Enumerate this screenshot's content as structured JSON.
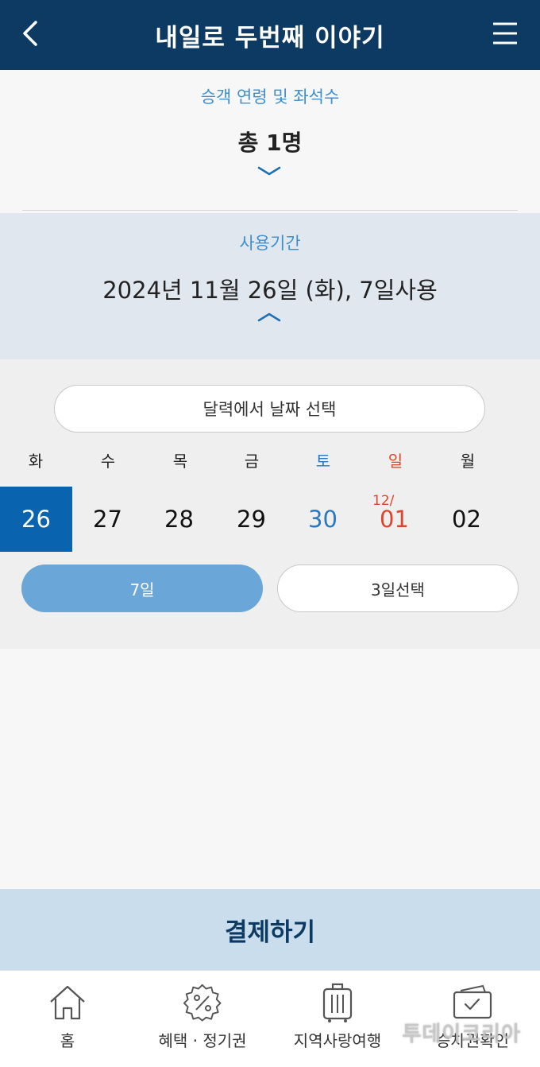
{
  "header": {
    "title": "내일로 두번째 이야기",
    "back_icon": "chevron-left-icon",
    "menu_icon": "hamburger-menu-icon"
  },
  "passenger": {
    "label": "승객 연령 및 좌석수",
    "value": "총 1명",
    "toggle_icon": "chevron-down-icon"
  },
  "period": {
    "label": "사용기간",
    "value": "2024년 11월 26일 (화), 7일사용",
    "toggle_icon": "chevron-up-icon"
  },
  "calendar": {
    "select_button": "달력에서 날짜 선택",
    "weekdays": [
      "화",
      "수",
      "목",
      "금",
      "토",
      "일",
      "월"
    ],
    "dates": [
      "26",
      "27",
      "28",
      "29",
      "30",
      "01",
      "02"
    ],
    "month_prefix": "12/",
    "selected_date": "26"
  },
  "duration": {
    "option_7": "7일",
    "option_3": "3일선택",
    "selected": "7일"
  },
  "pay_button": "결제하기",
  "bottom_nav": {
    "items": [
      {
        "label": "홈",
        "icon": "home-icon"
      },
      {
        "label": "혜택 · 정기권",
        "icon": "discount-badge-icon"
      },
      {
        "label": "지역사랑여행",
        "icon": "suitcase-icon"
      },
      {
        "label": "승차권확인",
        "icon": "ticket-check-icon"
      }
    ]
  },
  "watermark": "투데이코리아",
  "colors": {
    "header_bg": "#0c3a63",
    "accent_blue": "#3e8fd0",
    "selected_date_bg": "#0a63ae",
    "saturday": "#2a78c2",
    "sunday": "#e0452c",
    "pay_bg": "#c9dded"
  }
}
